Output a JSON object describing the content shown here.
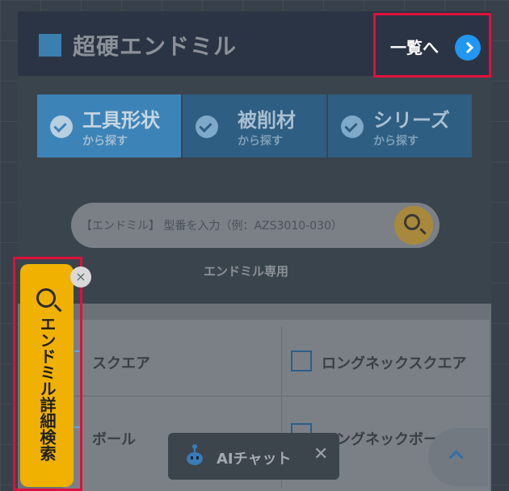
{
  "header": {
    "title": "超硬エンドミル",
    "list_link_label": "一覧へ"
  },
  "tabs": [
    {
      "label": "工具形状",
      "sub": "から探す",
      "active": true
    },
    {
      "label": "被削材",
      "sub": "から探す",
      "active": false
    },
    {
      "label": "シリーズ",
      "sub": "から探す",
      "active": false
    }
  ],
  "search": {
    "placeholder": "【エンドミル】 型番を入力（例：AZS3010-030）",
    "note": "エンドミル専用"
  },
  "shapes": [
    {
      "label": "スクエア"
    },
    {
      "label": "ロングネックスクエア"
    },
    {
      "label": "ボール"
    },
    {
      "label": "ロングネックボー"
    }
  ],
  "side_search": {
    "label": "エンドミル詳細検索",
    "close_symbol": "×"
  },
  "ai_chat": {
    "label": "AIチャット",
    "close_symbol": "✕"
  },
  "colors": {
    "accent_blue": "#2196f3",
    "highlight_red": "#e0103a",
    "side_yellow": "#f0b100"
  }
}
